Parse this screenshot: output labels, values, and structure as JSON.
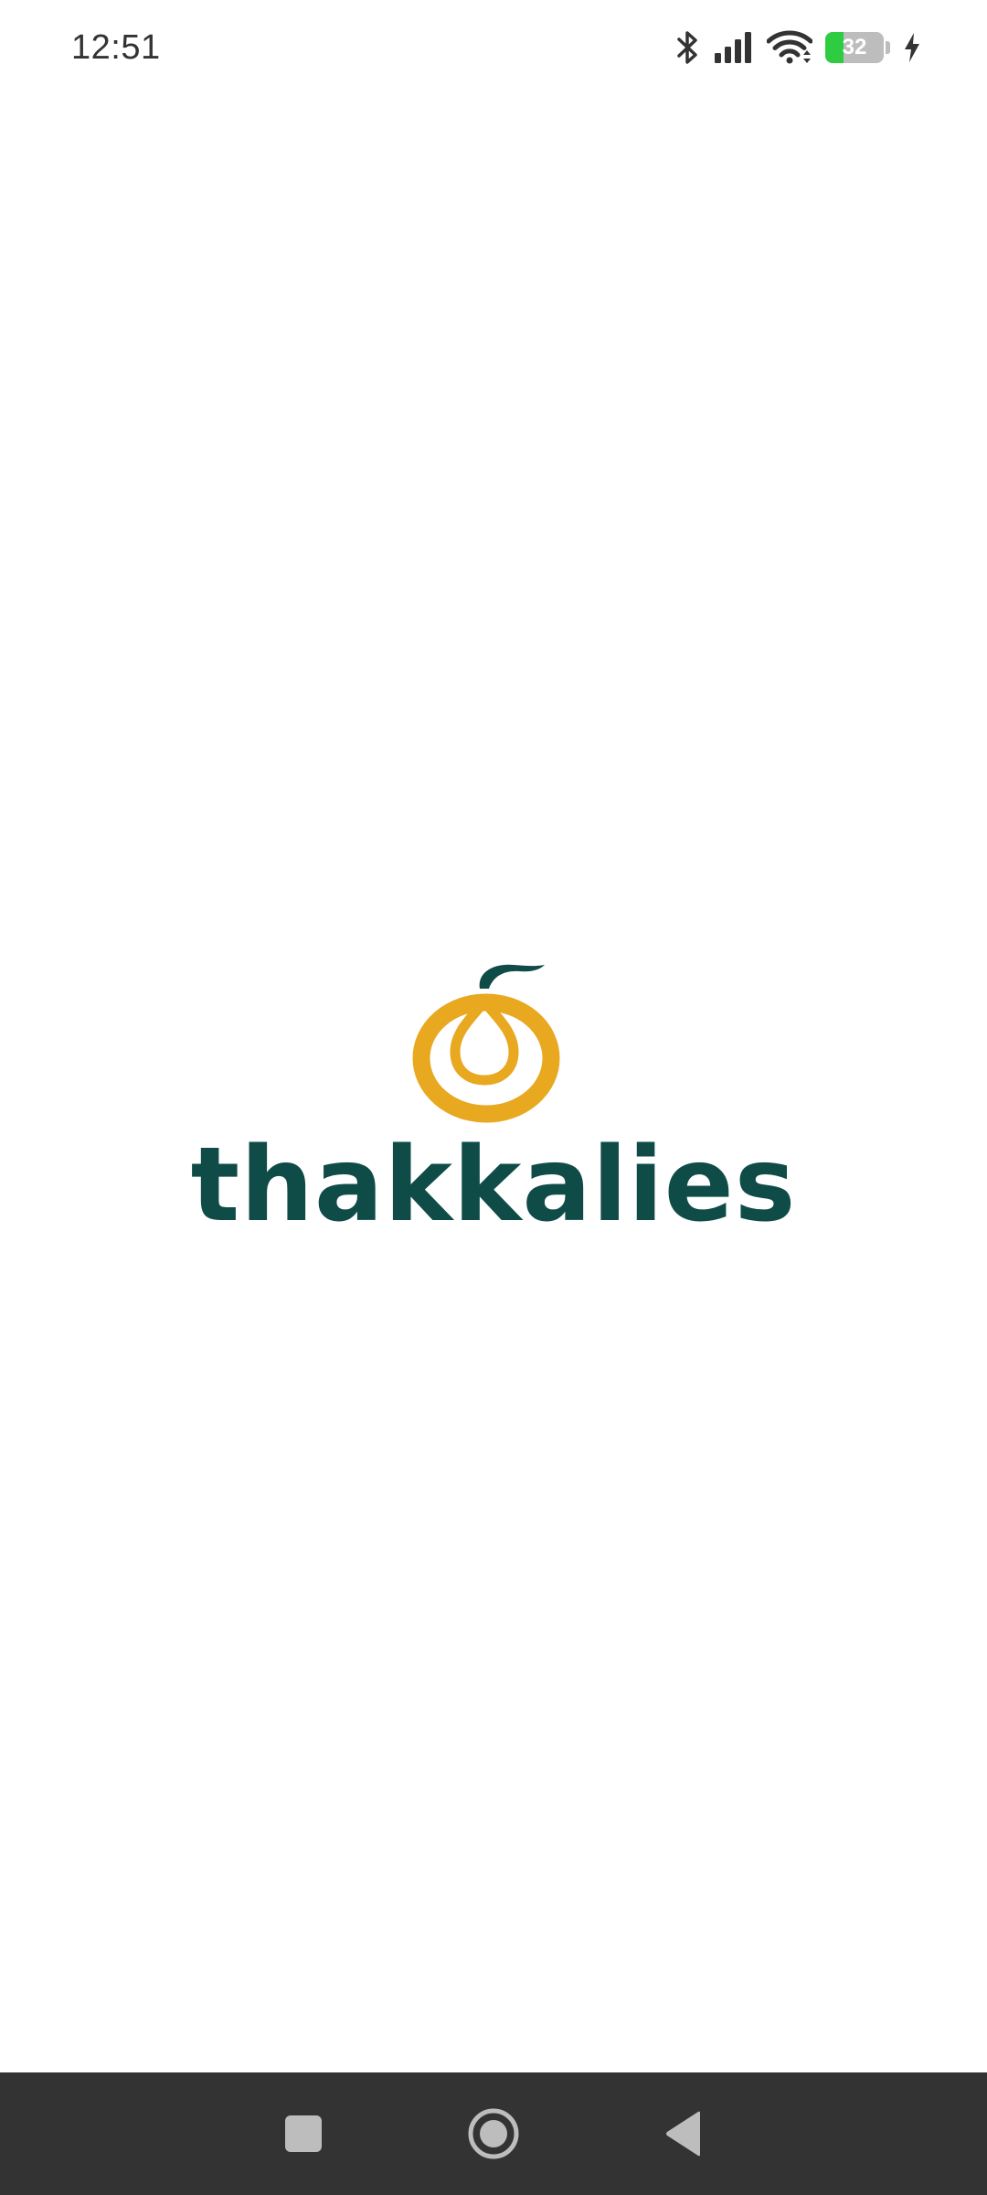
{
  "status_bar": {
    "time": "12:51",
    "battery_level": "32",
    "battery_fraction": 0.32,
    "icons": [
      "bluetooth-icon",
      "signal-icon",
      "wifi-icon",
      "battery-icon",
      "charging-icon"
    ]
  },
  "brand": {
    "name": "thakkalies",
    "colors": {
      "primary": "#0f4c48",
      "accent": "#e8a820"
    }
  },
  "nav_bar": {
    "buttons": [
      "recents-button",
      "home-button",
      "back-button"
    ],
    "background": "#333333"
  }
}
